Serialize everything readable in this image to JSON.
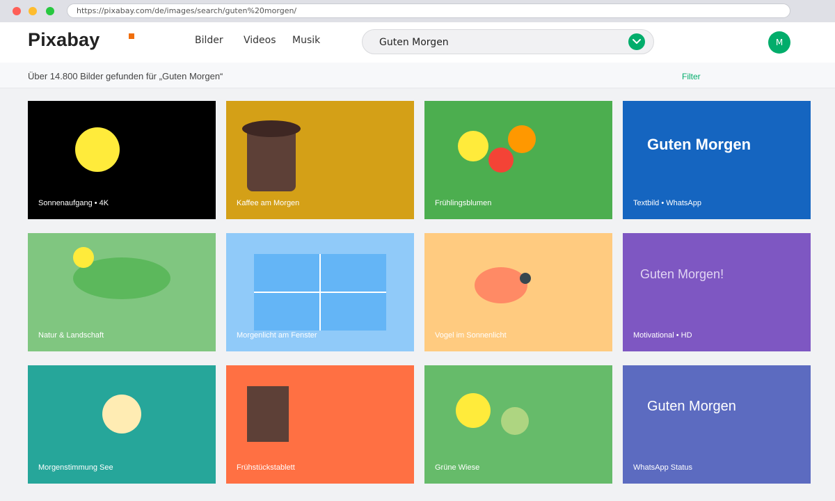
{
  "browser": {
    "url": "https://pixabay.com/de/images/search/guten%20morgen/"
  },
  "header": {
    "logo": "Pixabay",
    "nav": [
      "Bilder",
      "Videos",
      "Musik"
    ],
    "search_value": "Guten Morgen",
    "avatar_initial": "M"
  },
  "results": {
    "summary": "Über 14.800 Bilder gefunden für „Guten Morgen“",
    "filter_label": "Filter"
  },
  "tiles": [
    {
      "caption": "Sonnenaufgang • 4K",
      "bg": "#000000"
    },
    {
      "caption": "Kaffee am Morgen",
      "bg": "#d4a017"
    },
    {
      "caption": "Frühlingsblumen",
      "bg": "#4cae4f"
    },
    {
      "caption": "Textbild • WhatsApp",
      "bg": "#1565c0",
      "text": "Guten Morgen"
    },
    {
      "caption": "Natur & Landschaft",
      "bg": "#80c680"
    },
    {
      "caption": "Morgenlicht am Fenster",
      "bg": "#90caf9"
    },
    {
      "caption": "Vogel im Sonnenlicht",
      "bg": "#ffcb80"
    },
    {
      "caption": "Motivational • HD",
      "bg": "#7e57c2",
      "text": "Guten Morgen!"
    },
    {
      "caption": "Morgenstimmung See",
      "bg": "#26a69a"
    },
    {
      "caption": "Frühstückstablett",
      "bg": "#ff7043"
    },
    {
      "caption": "Grüne Wiese",
      "bg": "#66bb6a"
    },
    {
      "caption": "WhatsApp Status",
      "bg": "#5c6bc0",
      "text": "Guten Morgen"
    }
  ],
  "colors": {
    "accent": "#02ad6b",
    "logo_mark": "#f06e0c"
  }
}
